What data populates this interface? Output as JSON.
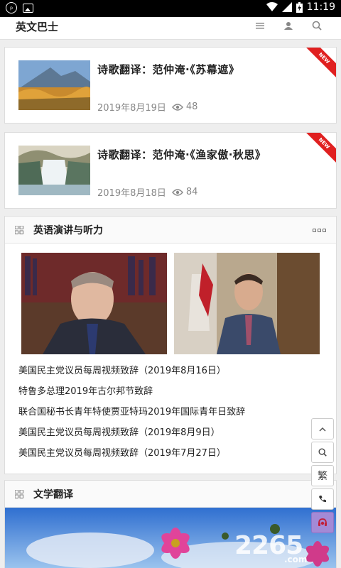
{
  "status_bar": {
    "time": "11:19",
    "battery_icon": "battery-charging-icon",
    "wifi_icon": "wifi-icon",
    "signal_icon": "signal-icon"
  },
  "header": {
    "title": "英文巴士",
    "icons": [
      "menu-icon",
      "user-icon",
      "search-icon"
    ]
  },
  "articles": [
    {
      "title": "诗歌翻译：范仲淹·《苏幕遮》",
      "date": "2019年8月19日",
      "views": "48",
      "badge": "NEW"
    },
    {
      "title": "诗歌翻译：范仲淹·《渔家傲·秋思》",
      "date": "2019年8月18日",
      "views": "84",
      "badge": "NEW"
    }
  ],
  "section_speech": {
    "title": "英语演讲与听力",
    "items": [
      "美国民主党议员每周视频致辞（2019年8月16日）",
      "特鲁多总理2019年古尔邦节致辞",
      "联合国秘书长青年特使贾亚特玛2019年国际青年日致辞",
      "美国民主党议员每周视频致辞（2019年8月9日）",
      "美国民主党议员每周视频致辞（2019年7月27日）"
    ]
  },
  "section_literature": {
    "title": "文学翻译"
  },
  "float_buttons": {
    "top": "⌃",
    "search": "search-icon",
    "traditional": "繁",
    "phone": "phone-icon",
    "service": "headset-icon"
  },
  "watermark": {
    "main": "2265",
    "sub": ".com"
  },
  "colors": {
    "new_badge": "#e02020",
    "service_button": "#a38ad6"
  }
}
